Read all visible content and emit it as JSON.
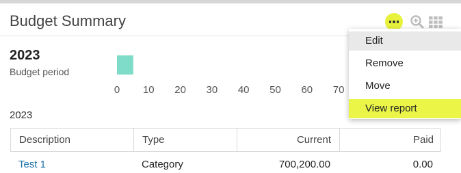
{
  "widget": {
    "title": "Budget Summary",
    "icons": {
      "more": "more-horizontal-icon",
      "zoom": "zoom-in-icon",
      "grid": "grid-view-icon"
    },
    "accent_color": "#e8f23c"
  },
  "period": {
    "year": "2023",
    "label": "Budget period"
  },
  "chart_data": {
    "type": "bar",
    "orientation": "horizontal",
    "categories": [
      "2023"
    ],
    "values": [
      3
    ],
    "xticks": [
      "0",
      "10",
      "20",
      "30",
      "40",
      "50",
      "60",
      "70"
    ],
    "xlim": [
      0,
      70
    ],
    "bar_color": "#7fdcc8"
  },
  "section": {
    "year": "2023"
  },
  "table": {
    "columns": [
      "Description",
      "Type",
      "Current",
      "Paid"
    ],
    "rows": [
      {
        "description": "Test 1",
        "type": "Category",
        "current": "700,200.00",
        "paid": "0.00"
      }
    ]
  },
  "menu": {
    "items": [
      "Edit",
      "Remove",
      "Move",
      "View report"
    ],
    "hovered": "Edit",
    "highlighted": "View report"
  }
}
